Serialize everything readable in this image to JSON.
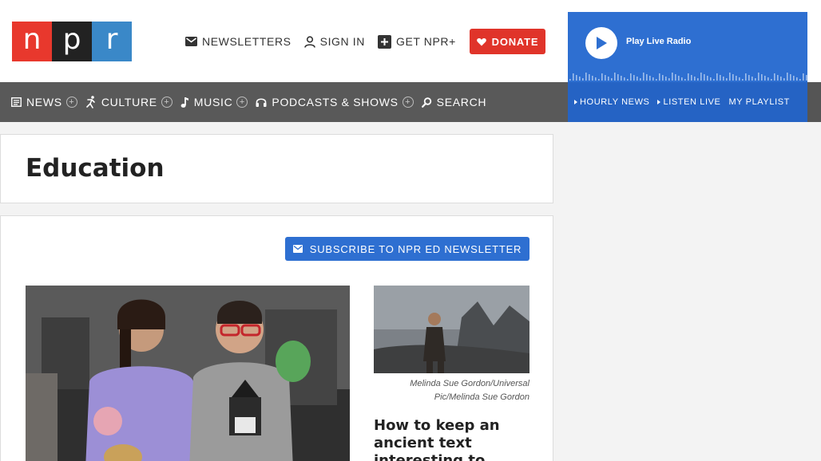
{
  "header": {
    "logo_letters": [
      "n",
      "p",
      "r"
    ],
    "utility_links": [
      {
        "label": "NEWSLETTERS",
        "icon": "mail-icon"
      },
      {
        "label": "SIGN IN",
        "icon": "user-icon"
      },
      {
        "label": "GET NPR+",
        "icon": "plus-square-icon"
      }
    ],
    "donate_label": "DONATE"
  },
  "player": {
    "play_label": "Play Live Radio",
    "links": [
      {
        "label": "HOURLY NEWS",
        "has_arrow": true
      },
      {
        "label": "LISTEN LIVE",
        "has_arrow": true
      },
      {
        "label": "MY PLAYLIST",
        "has_arrow": false
      }
    ]
  },
  "nav": {
    "items": [
      {
        "label": "NEWS",
        "icon": "newspaper-icon",
        "expandable": true
      },
      {
        "label": "CULTURE",
        "icon": "dancer-icon",
        "expandable": true
      },
      {
        "label": "MUSIC",
        "icon": "music-note-icon",
        "expandable": true
      },
      {
        "label": "PODCASTS & SHOWS",
        "icon": "headphones-icon",
        "expandable": true
      },
      {
        "label": "SEARCH",
        "icon": "search-icon",
        "expandable": false
      }
    ]
  },
  "page": {
    "title": "Education",
    "subscribe_label": "SUBSCRIBE TO NPR ED NEWSLETTER"
  },
  "stories": {
    "side": {
      "credit": "Melinda Sue Gordon/Universal Pic/Melinda Sue Gordon",
      "title": "How to keep an ancient text interesting to"
    }
  },
  "colors": {
    "npr_red": "#e8382d",
    "npr_black": "#222222",
    "npr_blue": "#3a88c8",
    "donate_red": "#e0342a",
    "player_blue": "#2e6fd1",
    "nav_gray": "#595959"
  }
}
